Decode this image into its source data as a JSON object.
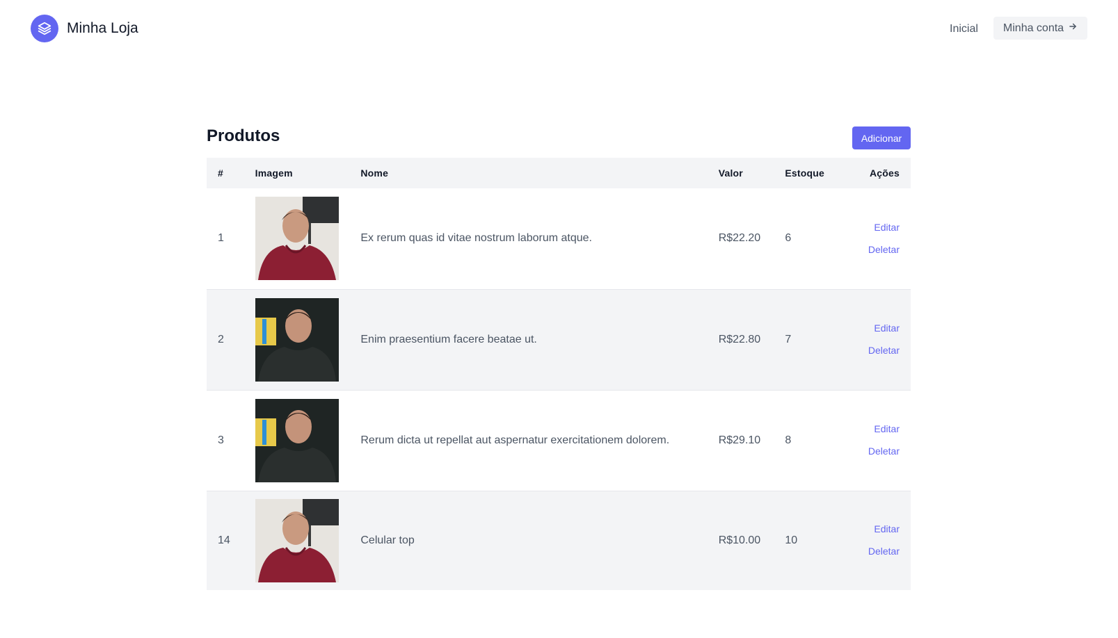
{
  "header": {
    "brand": "Minha Loja",
    "nav_home": "Inicial",
    "nav_account": "Minha conta"
  },
  "page": {
    "title": "Produtos",
    "add_button": "Adicionar"
  },
  "table": {
    "columns": [
      "#",
      "Imagem",
      "Nome",
      "Valor",
      "Estoque",
      "Ações"
    ],
    "rows": [
      {
        "id": "1",
        "image": "photo-red-hoodie",
        "name": "Ex rerum quas id vitae nostrum laborum atque.",
        "price": "R$22.20",
        "stock": "6",
        "edit": "Editar",
        "delete": "Deletar"
      },
      {
        "id": "2",
        "image": "photo-dark-shirt",
        "name": "Enim praesentium facere beatae ut.",
        "price": "R$22.80",
        "stock": "7",
        "edit": "Editar",
        "delete": "Deletar"
      },
      {
        "id": "3",
        "image": "photo-dark-shirt",
        "name": "Rerum dicta ut repellat aut aspernatur exercitationem dolorem.",
        "price": "R$29.10",
        "stock": "8",
        "edit": "Editar",
        "delete": "Deletar"
      },
      {
        "id": "14",
        "image": "photo-red-hoodie",
        "name": "Celular top",
        "price": "R$10.00",
        "stock": "10",
        "edit": "Editar",
        "delete": "Deletar"
      }
    ]
  },
  "icons": {
    "logo": "layers-icon",
    "account_arrow": "arrow-right-icon"
  },
  "colors": {
    "accent": "#6366f1",
    "row_alt": "#f3f4f6",
    "text": "#4b5563"
  }
}
